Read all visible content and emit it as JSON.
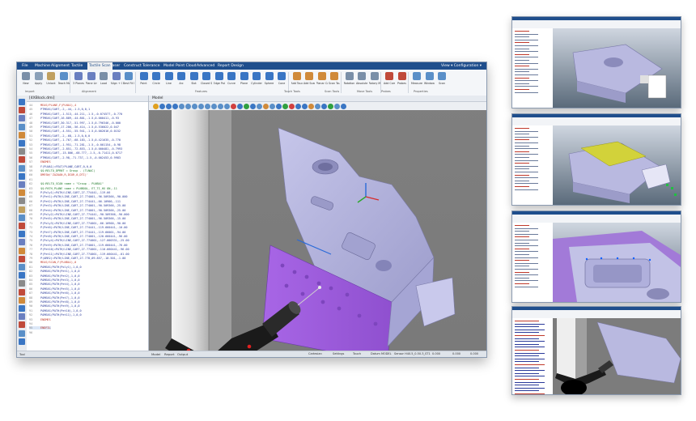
{
  "main": {
    "menu": [
      "File",
      "Machine",
      "Alignment",
      "Tactile",
      "Tactile Scan",
      "Laser",
      "Construct",
      "Tolerance",
      "Model",
      "Point Cloud",
      "Advanced",
      "Report Design"
    ],
    "menu_active_index": 4,
    "menu_right": "View ▾  Configuration ▾",
    "ribbon": {
      "tools": [
        {
          "label": "New",
          "color": "#7a8fa8"
        },
        {
          "label": "Apply",
          "color": "#8aa0b8"
        },
        {
          "label": "Unlock",
          "color": "#c0a060"
        },
        {
          "label": "Teach Mode",
          "color": "#5a8fc8"
        },
        {
          "label": "3 Planes",
          "color": "#6a7fc0"
        },
        {
          "label": "Plane Line Point",
          "color": "#6a7fc0"
        },
        {
          "label": "Load",
          "color": "#7a8fa8"
        },
        {
          "label": "Align + Circles",
          "color": "#6a7fc0"
        },
        {
          "label": "Best Fit Radius",
          "color": "#5a8fc8"
        },
        {
          "label": "Point",
          "color": "#3a76c4"
        },
        {
          "label": "Circle",
          "color": "#3a76c4"
        },
        {
          "label": "Line",
          "color": "#3a76c4"
        },
        {
          "label": "Arc",
          "color": "#3a76c4"
        },
        {
          "label": "Slot",
          "color": "#3a76c4"
        },
        {
          "label": "Closed Slot",
          "color": "#3a76c4"
        },
        {
          "label": "Edge Point",
          "color": "#3a76c4"
        },
        {
          "label": "Curve",
          "color": "#3a76c4"
        },
        {
          "label": "Plane",
          "color": "#3a76c4"
        },
        {
          "label": "Cylinder",
          "color": "#3a76c4"
        },
        {
          "label": "Sphere",
          "color": "#3a76c4"
        },
        {
          "label": "Cone",
          "color": "#3a76c4"
        },
        {
          "label": "Add Touches",
          "color": "#d08a3a"
        },
        {
          "label": "Add Scans",
          "color": "#d08a3a"
        },
        {
          "label": "Planar Contour",
          "color": "#d08a3a"
        },
        {
          "label": "Scan Touch",
          "color": "#d08a3a"
        },
        {
          "label": "Rotation",
          "color": "#7a8fa8"
        },
        {
          "label": "Absolute",
          "color": "#7a8fa8"
        },
        {
          "label": "Rotary Move",
          "color": "#7a8fa8"
        },
        {
          "label": "Add Camera Sketch",
          "color": "#c04a3a"
        },
        {
          "label": "Probes",
          "color": "#c04a3a"
        },
        {
          "label": "Measurement",
          "color": "#5a8fc8"
        },
        {
          "label": "Window",
          "color": "#5a8fc8"
        },
        {
          "label": "Scan",
          "color": "#5a8fc8"
        }
      ],
      "groups": [
        "Import",
        "Alignment",
        "Features",
        "Touch Tools",
        "Scan Tools",
        "Move Tools",
        "Probes",
        "Properties"
      ]
    },
    "code_panel": {
      "title": "[4XBlock.dmi]",
      "lines": [
        {
          "n": "44",
          "t": "MEAS/PLANE,F(PLNA1),4"
        },
        {
          "n": "45",
          "t": "PTMEAS/CART,-2,-44,-1.5,0,0,1"
        },
        {
          "n": "46",
          "t": "PTMEAS/CART,-1.513,-44.211,-1.5,-0.074577,-0.770"
        },
        {
          "n": "47",
          "t": "PTMEAS/CART,16.889,-44.801,-1.5,0.000411,-0.93"
        },
        {
          "n": "48",
          "t": "PTMEAS/CART,30.317,-51.997,-1.5,0.796346,-0.000"
        },
        {
          "n": "49",
          "t": "PTMEAS/CART,17.286,-56.414,-1.5,0.536022,0.047"
        },
        {
          "n": "50",
          "t": "PTMEAS/CART,-4.551,-55.941,-1.5,0.002616,0.0152"
        },
        {
          "n": "51",
          "t": "PTMEAS/CART,-2,-68,-1.5,0,0,0"
        },
        {
          "n": "52",
          "t": "PTMEAS/CART,-1.767,-68.183,-1.5,0.421635,-0.770"
        },
        {
          "n": "53",
          "t": "PTMEAS/CART,-1.951,-71.281,-1.5,-0.001154,-0.98"
        },
        {
          "n": "54",
          "t": "PTMEAS/CART,-2.851,-72.853,-1.5,0.000481,-0.7993"
        },
        {
          "n": "55",
          "t": "PTMEAS/CART,-15.806,-68.777,-1.5,-0.71411,0.0717"
        },
        {
          "n": "56",
          "t": "PTMEAS/CART,-2.98,-71.737,-1.5,-0.002453,0.9983"
        },
        {
          "n": "57",
          "t": "ENDMES"
        },
        {
          "n": "58",
          "t": "F(PLNA1)=FEAT/PLANE,CART,0,0,0"
        },
        {
          "n": "59",
          "t": "$$:RELTO_DPRNT = Group - (TLNAC)"
        },
        {
          "n": "60",
          "t": "DMESW/'ZAZAAN,R,DIOR,0,DTI)'"
        },
        {
          "n": "61",
          "t": ""
        },
        {
          "n": "62",
          "t": "$$:RELTO_SCAN name = \"Group - PLNBA1\""
        },
        {
          "n": "63",
          "t": "$$:PATH_PLANE name = PLNBOOL, ET_TI_HX ON,-11"
        },
        {
          "n": "64",
          "t": "P(Poly1)=PATH/LINE,CART,27.774441,-119.66"
        },
        {
          "n": "65",
          "t": "P(Pet1)=PATH/LINE,CART,27.774001,-96.509366,-90.000"
        },
        {
          "n": "66",
          "t": "P(Pet2)=PATH/LINE,CART,27.774441,-66.10900,-111"
        },
        {
          "n": "67",
          "t": "P(Pet3)=PATH/LINE,CART,27.774001,-90.509366,-25.00"
        },
        {
          "n": "68",
          "t": "P(Pet4)=PATH/LINE,CART,27.774001,-90.509366,-25.00"
        },
        {
          "n": "69",
          "t": "P(Poly2)=PATH/LINE,CART,27.774441,-90.509366,-90.000"
        },
        {
          "n": "70",
          "t": "P(Pet5)=PATH/LINE,CART,27.774001,-96.509366,-15.00"
        },
        {
          "n": "71",
          "t": "P(Poly3)=PATH/LINE,CART,27.774001,-66.10900,-90.00"
        },
        {
          "n": "72",
          "t": "P(Pet6)=PATH/LINE,CART,27.774441,-119.660441,-10.00"
        },
        {
          "n": "73",
          "t": "P(Pet7)=PATH/LINE,CART,27.774441,-119.66001,-94.00"
        },
        {
          "n": "74",
          "t": "P(Pet8)=PATH/LINE,CART,27.774001,-120.660441,-96.00"
        },
        {
          "n": "75",
          "t": "P(Poly4)=PATH/LINE,CART,27.774001,-127.000331,-25.00"
        },
        {
          "n": "76",
          "t": "P(Pet9)=PATH/LINE,CART,27.774001,-119.660441,-76.00"
        },
        {
          "n": "77",
          "t": "P(Pet10)=PATH/LINE,CART,27.774001,-110.660441,-96.00"
        },
        {
          "n": "78",
          "t": "P(Pet11)=PATH/LINE,CART,27.774001,-119.660441,-01.00"
        },
        {
          "n": "79",
          "t": "P(ARR2)=PATH/LINE,CART,27.778,09.857,-10.501,-1.00"
        },
        {
          "n": "80",
          "t": "MEAS/SCAN,F(PLNBA1),0"
        },
        {
          "n": "81",
          "t": "PAMEAS/PATH(Poly1),1,0,0"
        },
        {
          "n": "82",
          "t": "PAMEAS/PATH(Pet1),1,0,0"
        },
        {
          "n": "83",
          "t": "PAMEAS/PATH(Pet2),1,0,0"
        },
        {
          "n": "84",
          "t": "PAMEAS/PATH(Pet3),1,0,0"
        },
        {
          "n": "85",
          "t": "PAMEAS/PATH(Pet4),1,0,0"
        },
        {
          "n": "86",
          "t": "PAMEAS/PATH(Pet5),1,0,0"
        },
        {
          "n": "87",
          "t": "PAMEAS/PATH(Pet6),1,0,0"
        },
        {
          "n": "88",
          "t": "PAMEAS/PATH(Pet7),1,0,0"
        },
        {
          "n": "89",
          "t": "PAMEAS/PATH(Pet8),1,0,0"
        },
        {
          "n": "90",
          "t": "PAMEAS/PATH(Pet9),1,0,0"
        },
        {
          "n": "91",
          "t": "PAMEAS/PATH(Pet10),1,0,0"
        },
        {
          "n": "92",
          "t": "PAMEAS/PATH(Pet11),1,0,0"
        },
        {
          "n": "93",
          "t": "ENDMES"
        },
        {
          "n": "94",
          "t": ""
        },
        {
          "n": "95",
          "t": "ENDFIL"
        },
        {
          "n": "96",
          "t": ""
        }
      ],
      "selected_index": 51
    },
    "viewport_title": "Model",
    "bottom_tabs": [
      "Model",
      "Report",
      "Output"
    ],
    "status": {
      "left": [
        "Tool"
      ],
      "right": [
        "Cartesian",
        "Settings",
        "Touch",
        "Datum MODEL",
        "Sensor H40.5_0.50.3_ST1",
        "0.000",
        "0.000",
        "0.000"
      ]
    }
  },
  "colors": {
    "menubar": "#1f4e8c",
    "part": "#b6b6de",
    "highlight": "#a066e0",
    "viewport_bg": "#7d7d7d",
    "probe_ball": "#111111"
  }
}
